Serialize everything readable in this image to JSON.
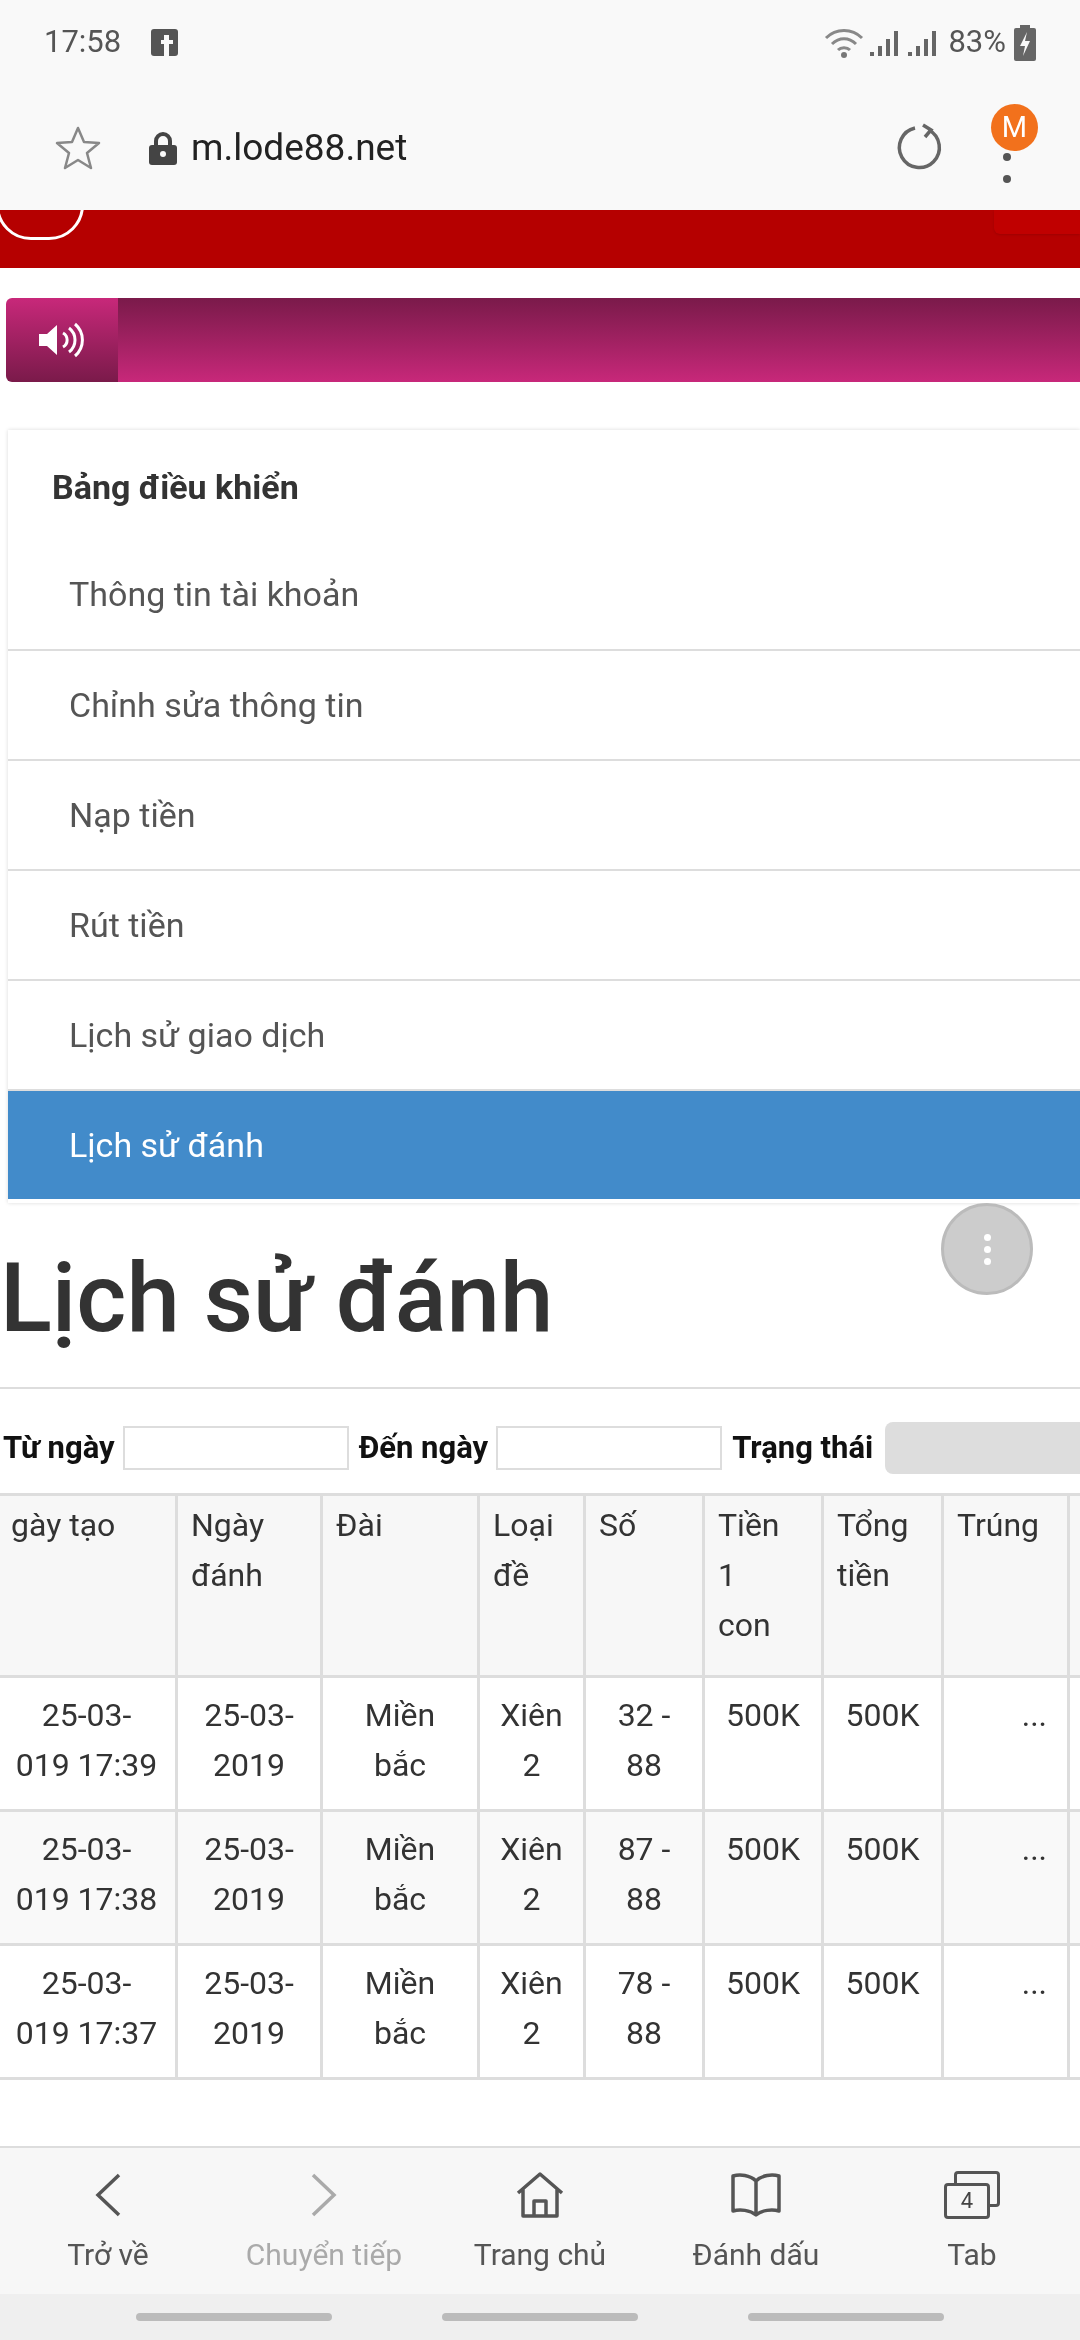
{
  "status_bar": {
    "time": "17:58",
    "battery": "83%"
  },
  "browser": {
    "url": "m.lode88.net",
    "profile_initial": "M"
  },
  "menu": {
    "title": "Bảng điều khiển",
    "items": [
      {
        "label": "Thông tin tài khoản",
        "selected": false
      },
      {
        "label": "Chỉnh sửa thông tin",
        "selected": false
      },
      {
        "label": "Nạp tiền",
        "selected": false
      },
      {
        "label": "Rút tiền",
        "selected": false
      },
      {
        "label": "Lịch sử giao dịch",
        "selected": false
      },
      {
        "label": "Lịch sử đánh",
        "selected": true
      }
    ]
  },
  "page_title": "Lịch sử đánh",
  "filters": {
    "from_label": "Từ ngày",
    "to_label": "Đến ngày",
    "status_label": "Trạng thái"
  },
  "table": {
    "columns": [
      "gày tạo",
      "Ngày\nđánh",
      "Đài",
      "Loại\nđề",
      "Số",
      "Tiền\n1\ncon",
      "Tổng\ntiền",
      "Trúng"
    ],
    "rows": [
      [
        "25-03-\n019 17:39",
        "25-03-\n2019",
        "Miền\nbắc",
        "Xiên\n2",
        "32 -\n88",
        "500K",
        "500K",
        "..."
      ],
      [
        "25-03-\n019 17:38",
        "25-03-\n2019",
        "Miền\nbắc",
        "Xiên\n2",
        "87 -\n88",
        "500K",
        "500K",
        "..."
      ],
      [
        "25-03-\n019 17:37",
        "25-03-\n2019",
        "Miền\nbắc",
        "Xiên\n2",
        "78 -\n88",
        "500K",
        "500K",
        "..."
      ]
    ]
  },
  "bottom_nav": [
    {
      "label": "Trở về",
      "kind": "back",
      "disabled": false
    },
    {
      "label": "Chuyển tiếp",
      "kind": "forward",
      "disabled": true
    },
    {
      "label": "Trang chủ",
      "kind": "home",
      "disabled": false
    },
    {
      "label": "Đánh dấu",
      "kind": "bookmarks",
      "disabled": false
    },
    {
      "label": "Tab",
      "kind": "tabs",
      "disabled": false,
      "count": "4"
    }
  ]
}
